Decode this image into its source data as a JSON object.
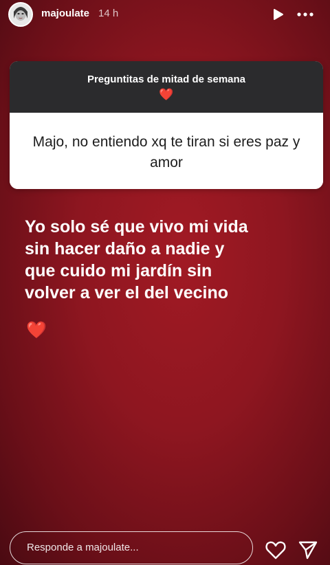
{
  "header": {
    "username": "majoulate",
    "time": "14 h"
  },
  "question_card": {
    "title": "Preguntitas de mitad de semana",
    "title_emoji": "❤️",
    "question": "Majo, no entiendo xq te tiran si eres paz y amor"
  },
  "answer": {
    "text": "Yo solo sé que vivo mi vida sin hacer daño a nadie y que cuido mi jardín sin volver a ver el del vecino",
    "emoji": "❤️"
  },
  "reply": {
    "placeholder": "Responde a majoulate..."
  },
  "icons": {
    "play": "play-icon",
    "more": "more-icon",
    "like": "heart-icon",
    "send": "send-icon"
  },
  "colors": {
    "background": "#8e1620",
    "card_header": "#2b2b2d",
    "heart": "#e0243b"
  }
}
